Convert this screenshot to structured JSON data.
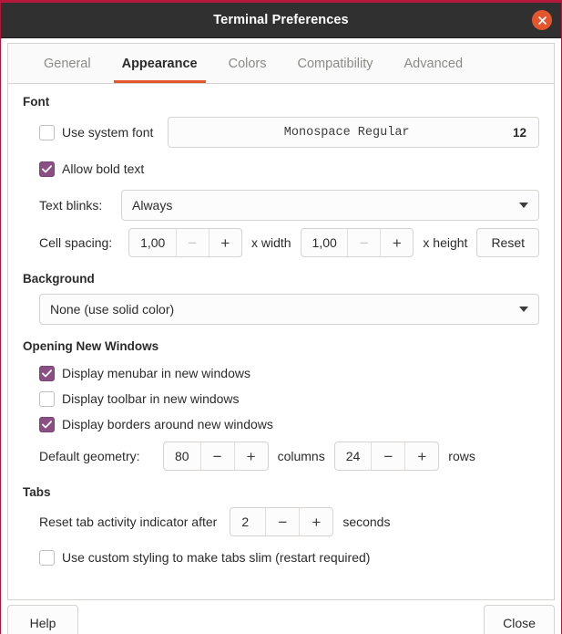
{
  "window": {
    "title": "Terminal Preferences",
    "close_icon": "close-icon",
    "accent_color": "#e4572e",
    "titlebar_color": "#303030",
    "checkbox_checked_color": "#8c4f84",
    "border_color": "#b3173c"
  },
  "tabs": [
    {
      "label": "General",
      "active": false
    },
    {
      "label": "Appearance",
      "active": true
    },
    {
      "label": "Colors",
      "active": false
    },
    {
      "label": "Compatibility",
      "active": false
    },
    {
      "label": "Advanced",
      "active": false
    }
  ],
  "font_section": {
    "title": "Font",
    "use_system_font": {
      "label": "Use system font",
      "checked": false
    },
    "font_button": {
      "name": "Monospace Regular",
      "size": "12"
    },
    "allow_bold_text": {
      "label": "Allow bold text",
      "checked": true
    },
    "text_blinks": {
      "label": "Text blinks:",
      "value": "Always"
    },
    "cell_spacing": {
      "label": "Cell spacing:",
      "width_value": "1,00",
      "width_unit": "x width",
      "height_value": "1,00",
      "height_unit": "x height",
      "reset_label": "Reset",
      "minus": "−",
      "plus": "+"
    }
  },
  "background_section": {
    "title": "Background",
    "value": "None (use solid color)"
  },
  "windows_section": {
    "title": "Opening New Windows",
    "checkboxes": [
      {
        "label": "Display menubar in new windows",
        "checked": true
      },
      {
        "label": "Display toolbar in new windows",
        "checked": false
      },
      {
        "label": "Display borders around new windows",
        "checked": true
      }
    ],
    "geometry": {
      "label": "Default geometry:",
      "columns_value": "80",
      "columns_unit": "columns",
      "rows_value": "24",
      "rows_unit": "rows",
      "minus": "−",
      "plus": "+"
    }
  },
  "tabs_section": {
    "title": "Tabs",
    "reset_indicator": {
      "label": "Reset tab activity indicator after",
      "value": "2",
      "unit": "seconds",
      "minus": "−",
      "plus": "+"
    },
    "custom_styling": {
      "label": "Use custom styling to make tabs slim (restart required)",
      "checked": false
    }
  },
  "footer": {
    "help_label": "Help",
    "close_label": "Close"
  }
}
